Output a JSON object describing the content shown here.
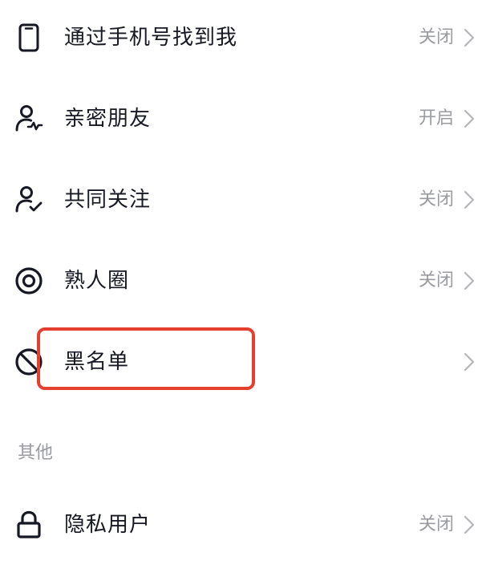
{
  "rows": [
    {
      "label": "通过手机号找到我",
      "value": "关闭",
      "icon": "phone-icon"
    },
    {
      "label": "亲密朋友",
      "value": "开启",
      "icon": "close-friend-icon"
    },
    {
      "label": "共同关注",
      "value": "关闭",
      "icon": "mutual-follow-icon"
    },
    {
      "label": "熟人圈",
      "value": "关闭",
      "icon": "circle-icon"
    },
    {
      "label": "黑名单",
      "value": "",
      "icon": "block-icon"
    }
  ],
  "other_section": {
    "title": "其他",
    "rows": [
      {
        "label": "隐私用户",
        "value": "关闭",
        "icon": "lock-icon"
      }
    ]
  },
  "colors": {
    "text_primary": "#161823",
    "text_secondary": "#9a9ba0",
    "highlight_border": "#e5402f"
  }
}
